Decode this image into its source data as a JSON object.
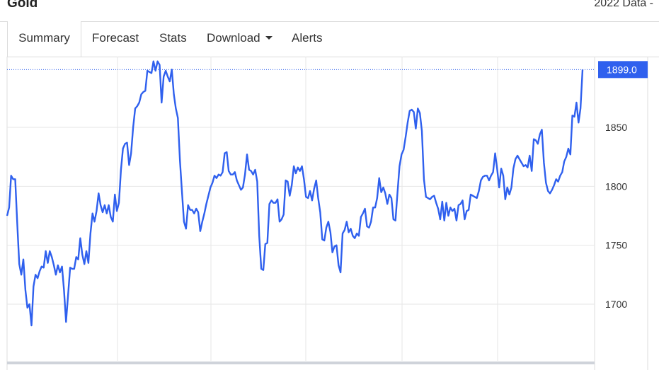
{
  "header": {
    "title": "Gold",
    "right_text": "2022 Data -"
  },
  "tabs": [
    {
      "label": "Summary",
      "active": true
    },
    {
      "label": "Forecast"
    },
    {
      "label": "Stats"
    },
    {
      "label": "Download",
      "has_dropdown": true
    },
    {
      "label": "Alerts"
    }
  ],
  "colors": {
    "line": "#2f60ee",
    "grid": "#e6e6e6",
    "label_bg": "#2f60ee"
  },
  "chart_data": {
    "type": "line",
    "ylim": [
      1652,
      1910
    ],
    "y_ticks": [
      1700,
      1750,
      1800,
      1850
    ],
    "last_value_label": "1899.0",
    "last_value": 1899,
    "series": [
      {
        "values": [
          1775,
          1782,
          1809,
          1806,
          1806,
          1768,
          1734,
          1725,
          1738,
          1712,
          1697,
          1700,
          1682,
          1715,
          1725,
          1722,
          1728,
          1732,
          1731,
          1745,
          1735,
          1745,
          1740,
          1733,
          1725,
          1733,
          1727,
          1732,
          1712,
          1685,
          1708,
          1731,
          1730,
          1730,
          1740,
          1738,
          1756,
          1742,
          1734,
          1745,
          1735,
          1760,
          1777,
          1770,
          1779,
          1794,
          1784,
          1778,
          1784,
          1777,
          1784,
          1774,
          1770,
          1793,
          1779,
          1786,
          1814,
          1832,
          1836,
          1837,
          1818,
          1828,
          1850,
          1866,
          1868,
          1871,
          1878,
          1880,
          1881,
          1898,
          1897,
          1896,
          1906,
          1898,
          1906,
          1903,
          1871,
          1893,
          1898,
          1893,
          1889,
          1899,
          1878,
          1866,
          1858,
          1822,
          1795,
          1770,
          1764,
          1784,
          1780,
          1780,
          1777,
          1781,
          1778,
          1762,
          1770,
          1777,
          1785,
          1792,
          1799,
          1803,
          1809,
          1807,
          1810,
          1809,
          1812,
          1828,
          1829,
          1813,
          1810,
          1810,
          1812,
          1805,
          1801,
          1797,
          1799,
          1810,
          1827,
          1814,
          1813,
          1810,
          1814,
          1804,
          1758,
          1730,
          1729,
          1751,
          1752,
          1785,
          1788,
          1786,
          1786,
          1789,
          1770,
          1772,
          1776,
          1805,
          1804,
          1792,
          1801,
          1817,
          1811,
          1816,
          1813,
          1817,
          1806,
          1791,
          1790,
          1796,
          1788,
          1798,
          1805,
          1790,
          1778,
          1755,
          1754,
          1765,
          1770,
          1761,
          1744,
          1749,
          1750,
          1733,
          1727,
          1760,
          1763,
          1770,
          1761,
          1764,
          1758,
          1756,
          1760,
          1758,
          1774,
          1777,
          1781,
          1766,
          1765,
          1770,
          1782,
          1782,
          1790,
          1807,
          1795,
          1799,
          1794,
          1785,
          1793,
          1790,
          1772,
          1771,
          1795,
          1817,
          1827,
          1831,
          1842,
          1854,
          1864,
          1865,
          1863,
          1849,
          1866,
          1862,
          1847,
          1806,
          1791,
          1790,
          1789,
          1791,
          1792,
          1786,
          1781,
          1772,
          1787,
          1771,
          1786,
          1775,
          1782,
          1779,
          1781,
          1771,
          1784,
          1785,
          1788,
          1772,
          1779,
          1780,
          1793,
          1792,
          1791,
          1790,
          1796,
          1805,
          1808,
          1809,
          1809,
          1805,
          1809,
          1812,
          1828,
          1815,
          1799,
          1815,
          1809,
          1789,
          1799,
          1793,
          1799,
          1815,
          1823,
          1826,
          1823,
          1820,
          1817,
          1818,
          1816,
          1826,
          1813,
          1840,
          1839,
          1836,
          1844,
          1848,
          1820,
          1803,
          1796,
          1794,
          1797,
          1801,
          1806,
          1804,
          1809,
          1812,
          1821,
          1825,
          1832,
          1827,
          1860,
          1859,
          1871,
          1854,
          1866,
          1899
        ]
      }
    ]
  }
}
